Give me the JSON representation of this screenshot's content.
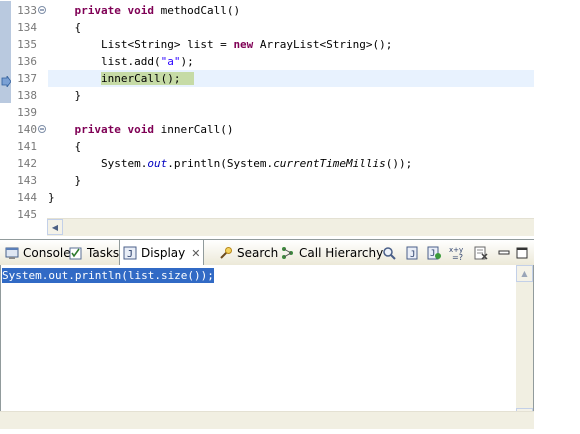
{
  "editor": {
    "lines": [
      {
        "num": "133",
        "fold": "minus"
      },
      {
        "num": "134"
      },
      {
        "num": "135"
      },
      {
        "num": "136"
      },
      {
        "num": "137",
        "current": true,
        "debug": true
      },
      {
        "num": "138"
      },
      {
        "num": "139"
      },
      {
        "num": "140",
        "fold": "minus"
      },
      {
        "num": "141"
      },
      {
        "num": "142"
      },
      {
        "num": "143"
      },
      {
        "num": "144"
      },
      {
        "num": "145"
      }
    ],
    "code": {
      "l133_kw": "    private void ",
      "l133_rest": "methodCall()",
      "l134": "    {",
      "l135_a": "        List<String> list = ",
      "l135_kw": "new",
      "l135_b": " ArrayList<String>();",
      "l136_a": "        list.add(",
      "l136_str": "\"a\"",
      "l136_b": ");",
      "l137_indent": "        ",
      "l137_mark": "innerCall();  ",
      "l138": "    }",
      "l139": "",
      "l140_kw": "    private void ",
      "l140_rest": "innerCall()",
      "l141": "    {",
      "l142_a": "        System.",
      "l142_out": "out",
      "l142_b": ".println(System.",
      "l142_ctm": "currentTimeMillis",
      "l142_c": "());",
      "l143": "    }",
      "l144": "}",
      "l145": ""
    }
  },
  "views": {
    "tabs": [
      {
        "label": "Console",
        "icon": "console-icon"
      },
      {
        "label": "Tasks",
        "icon": "tasks-icon"
      },
      {
        "label": "Display",
        "icon": "display-icon",
        "active": true
      },
      {
        "label": "Search",
        "icon": "search-icon"
      },
      {
        "label": "Call Hierarchy",
        "icon": "call-hierarchy-icon"
      }
    ],
    "toolbar": [
      "find-icon",
      "inspect-icon",
      "display-result-icon",
      "execute-icon",
      "clear-icon",
      "minimize-icon",
      "maximize-icon"
    ]
  },
  "display": {
    "text": "System.out.println(list.size());"
  },
  "colors": {
    "keyword": "#7f0055",
    "string": "#2a00ff",
    "current_line": "#e8f2fe",
    "debug_mark": "#c6dba6",
    "selection": "#316ac5"
  }
}
